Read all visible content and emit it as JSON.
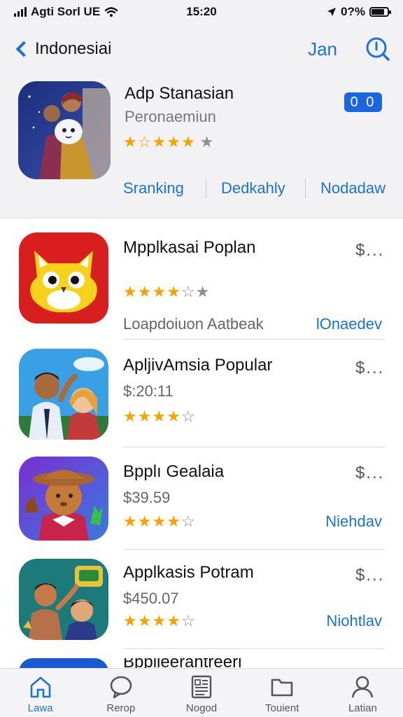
{
  "status_bar": {
    "carrier": "Agti Sorl UE",
    "time": "15:20",
    "battery": "0?%"
  },
  "nav": {
    "back_label": "Indonesiai",
    "action_label": "Jan"
  },
  "featured": {
    "title": "Adp Stanasian",
    "subtitle": "Peronaemiun",
    "rating": 4.5,
    "badge": "0 0",
    "tabs": [
      "Sranking",
      "Dedkahly",
      "Nodadaw"
    ]
  },
  "apps": [
    {
      "name": "Mpplkasai Poplan",
      "more": "$...",
      "meta": "Loapdoiuon Aatbeak",
      "action": "lOnaedev",
      "rating": 4
    },
    {
      "name": "ApljivAmsia Popular",
      "more": "$...",
      "price": "$:20:11",
      "rating": 4
    },
    {
      "name": "Bpplı Gealaia",
      "more": "$...",
      "price": "$39.59",
      "action": "Niehdav",
      "rating": 4
    },
    {
      "name": "Applkasis Potram",
      "more": "$...",
      "price": "$450.07",
      "action": "Niohtlav",
      "rating": 4
    },
    {
      "name": "Bpplleerantreerl"
    }
  ],
  "tab_bar": {
    "items": [
      {
        "label": "Lawa",
        "icon": "home-icon"
      },
      {
        "label": "Rerop",
        "icon": "chat-bubble-icon"
      },
      {
        "label": "Nogod",
        "icon": "news-icon"
      },
      {
        "label": "Touient",
        "icon": "folder-icon"
      },
      {
        "label": "Latian",
        "icon": "person-icon"
      }
    ]
  },
  "colors": {
    "accent": "#1a73d9",
    "star": "#f5a300",
    "badge": "#1a66e0"
  }
}
